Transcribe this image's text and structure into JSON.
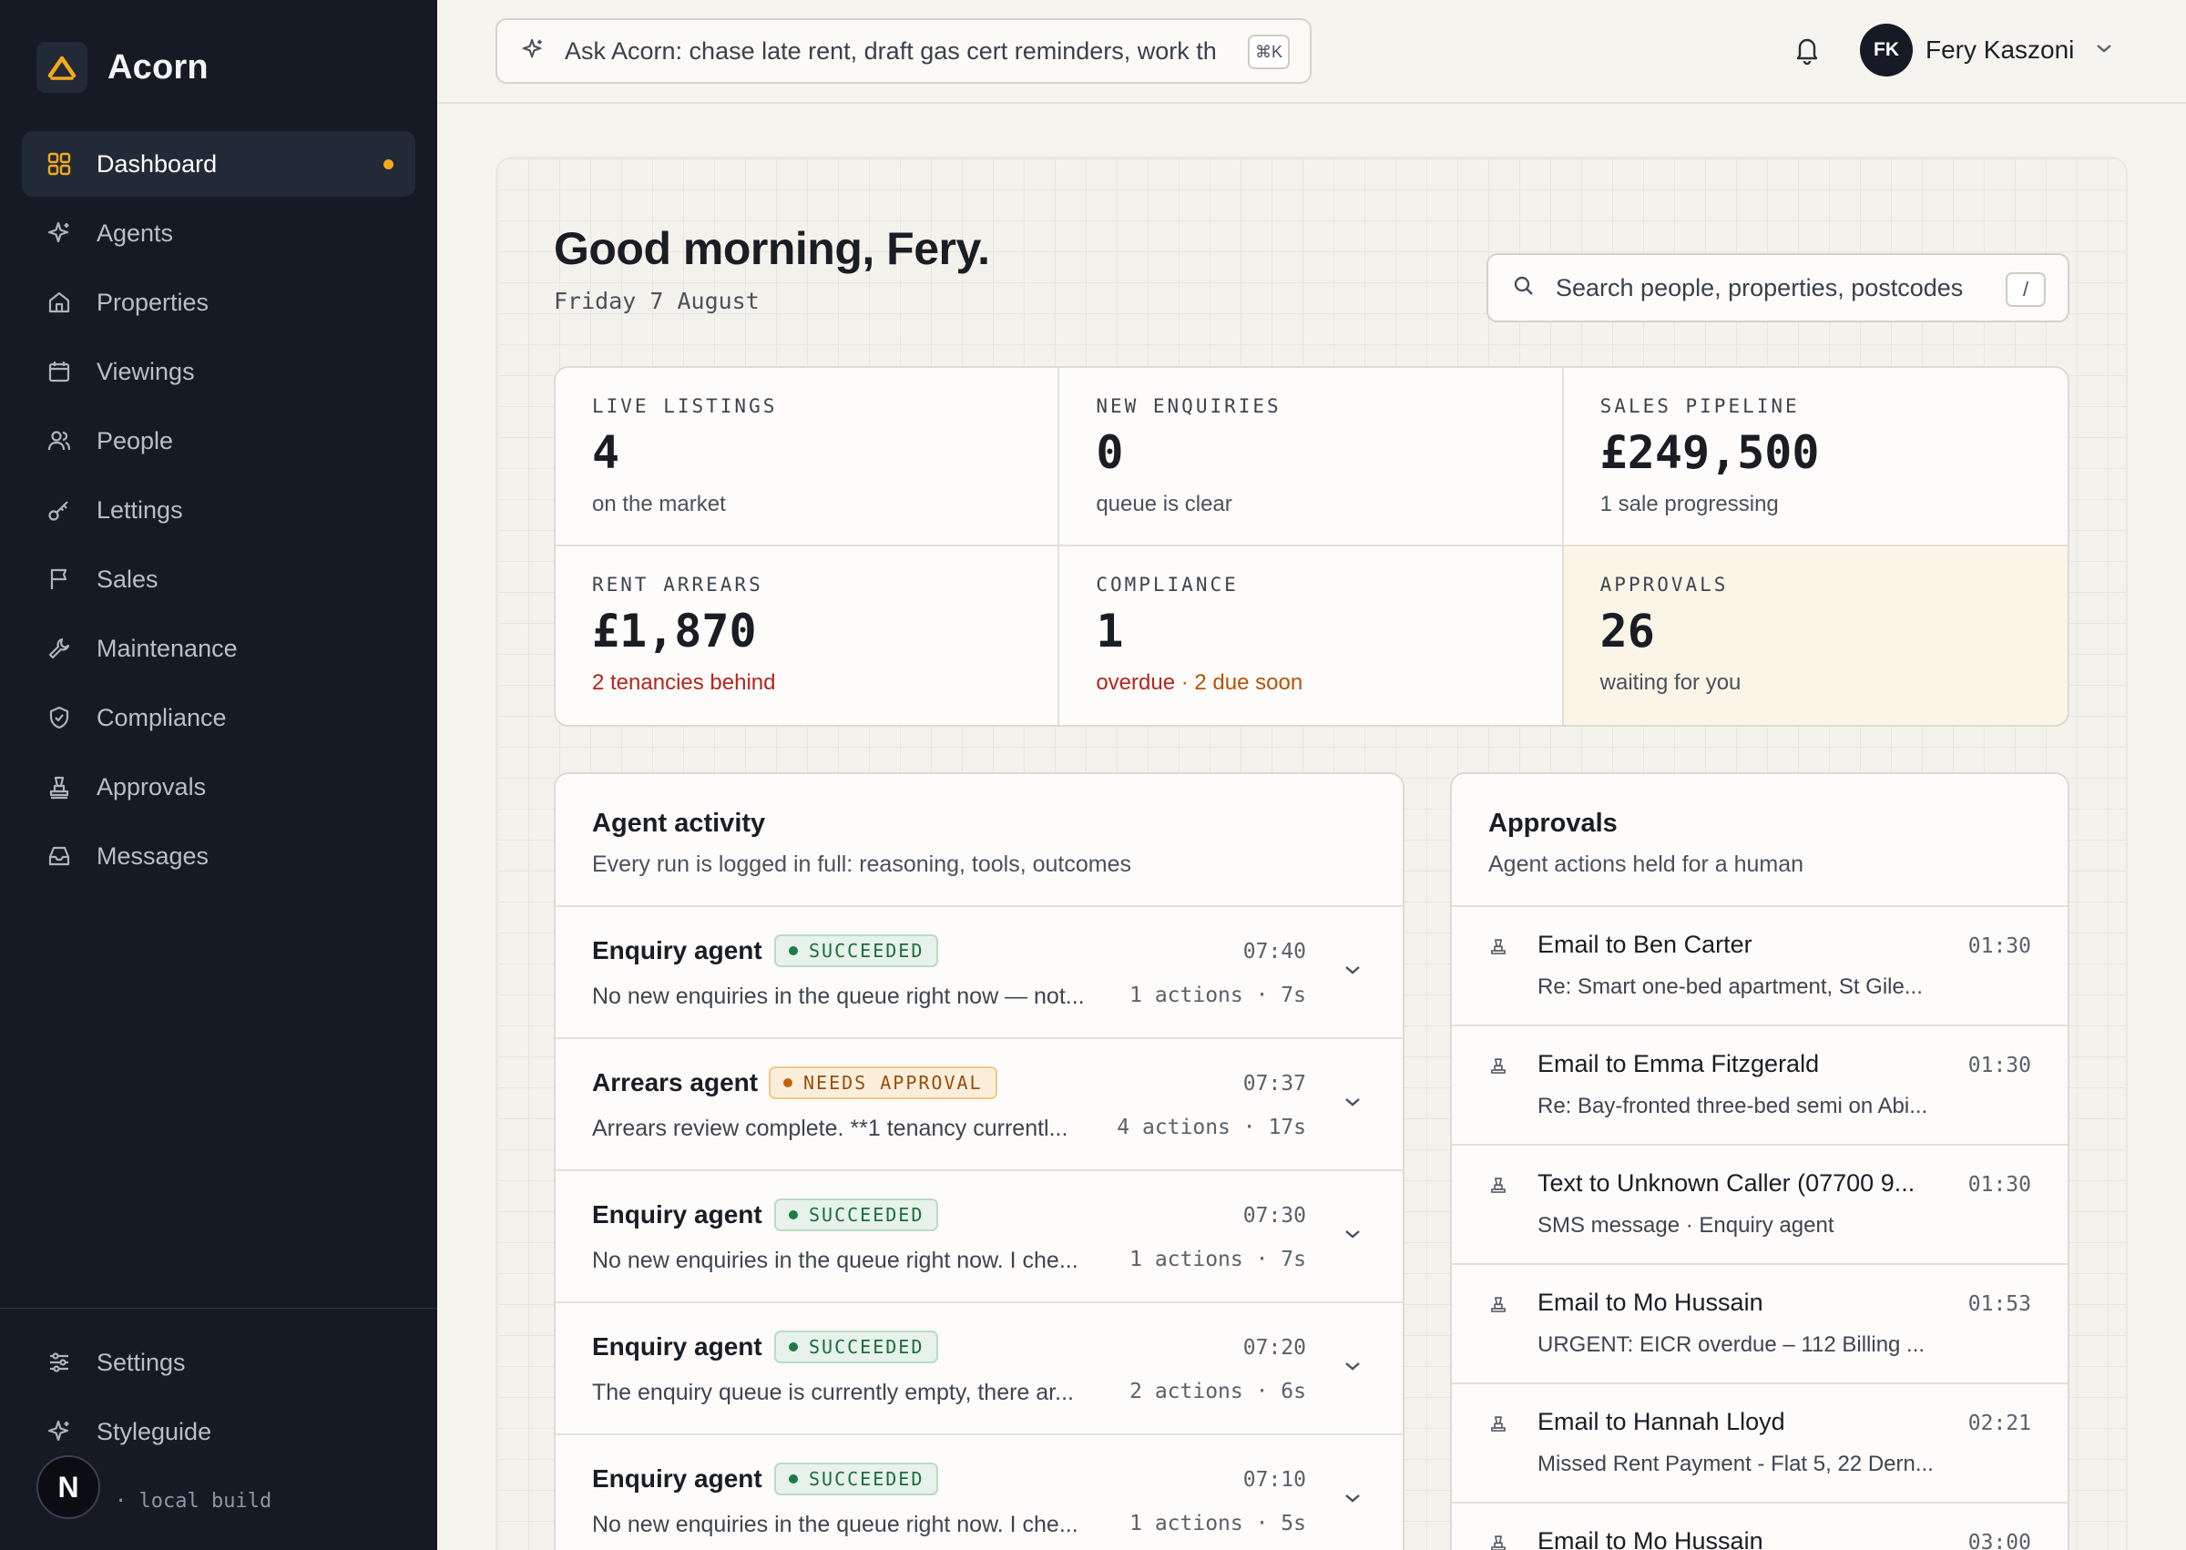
{
  "brand": {
    "name": "Acorn"
  },
  "sidebar": {
    "items": [
      {
        "label": "Dashboard",
        "icon": "grid-icon",
        "active": true
      },
      {
        "label": "Agents",
        "icon": "sparkle-icon"
      },
      {
        "label": "Properties",
        "icon": "home-icon"
      },
      {
        "label": "Viewings",
        "icon": "calendar-icon"
      },
      {
        "label": "People",
        "icon": "users-icon"
      },
      {
        "label": "Lettings",
        "icon": "key-icon"
      },
      {
        "label": "Sales",
        "icon": "flag-icon"
      },
      {
        "label": "Maintenance",
        "icon": "wrench-icon"
      },
      {
        "label": "Compliance",
        "icon": "shield-icon"
      },
      {
        "label": "Approvals",
        "icon": "stamp-icon"
      },
      {
        "label": "Messages",
        "icon": "inbox-icon"
      }
    ],
    "bottom": [
      {
        "label": "Settings",
        "icon": "sliders-icon"
      },
      {
        "label": "Styleguide",
        "icon": "sparkle-icon"
      }
    ],
    "build": "· local build",
    "n_badge": "N"
  },
  "topbar": {
    "ask_placeholder": "Ask Acorn: chase late rent, draft gas cert reminders, work th",
    "ask_shortcut": "⌘K",
    "user": {
      "initials": "FK",
      "name": "Fery Kaszoni"
    }
  },
  "header": {
    "greeting": "Good morning, Fery.",
    "date": "Friday 7 August",
    "search_placeholder": "Search people, properties, postcodes",
    "search_shortcut": "/"
  },
  "stats": [
    {
      "label": "LIVE LISTINGS",
      "value": "4",
      "sub": "on the market"
    },
    {
      "label": "NEW ENQUIRIES",
      "value": "0",
      "sub": "queue is clear"
    },
    {
      "label": "SALES PIPELINE",
      "value": "£249,500",
      "sub": "1 sale progressing"
    },
    {
      "label": "RENT ARREARS",
      "value": "£1,870",
      "sub": "2 tenancies behind"
    },
    {
      "label": "COMPLIANCE",
      "value": "1",
      "sub_a": "overdue",
      "sub_b": " · 2 due soon"
    },
    {
      "label": "APPROVALS",
      "value": "26",
      "sub": "waiting for you"
    }
  ],
  "activity": {
    "title": "Agent activity",
    "subtitle": "Every run is logged in full: reasoning, tools, outcomes",
    "rows": [
      {
        "agent": "Enquiry agent",
        "status": "SUCCEEDED",
        "summary": "No new enquiries in the queue right now — not...",
        "time": "07:40",
        "meta": "1 actions · 7s"
      },
      {
        "agent": "Arrears agent",
        "status": "NEEDS APPROVAL",
        "summary": "Arrears review complete. **1 tenancy currentl...",
        "time": "07:37",
        "meta": "4 actions · 17s"
      },
      {
        "agent": "Enquiry agent",
        "status": "SUCCEEDED",
        "summary": "No new enquiries in the queue right now. I che...",
        "time": "07:30",
        "meta": "1 actions · 7s"
      },
      {
        "agent": "Enquiry agent",
        "status": "SUCCEEDED",
        "summary": "The enquiry queue is currently empty, there ar...",
        "time": "07:20",
        "meta": "2 actions · 6s"
      },
      {
        "agent": "Enquiry agent",
        "status": "SUCCEEDED",
        "summary": "No new enquiries in the queue right now. I che...",
        "time": "07:10",
        "meta": "1 actions · 5s"
      }
    ]
  },
  "approvals": {
    "title": "Approvals",
    "subtitle": "Agent actions held for a human",
    "rows": [
      {
        "title": "Email to Ben Carter",
        "sub": "Re: Smart one-bed apartment, St Gile...",
        "time": "01:30"
      },
      {
        "title": "Email to Emma Fitzgerald",
        "sub": "Re: Bay-fronted three-bed semi on Abi...",
        "time": "01:30"
      },
      {
        "title": "Text to Unknown Caller (07700 9...",
        "sub": "SMS message · Enquiry agent",
        "time": "01:30"
      },
      {
        "title": "Email to Mo Hussain",
        "sub": "URGENT: EICR overdue – 112 Billing ...",
        "time": "01:53"
      },
      {
        "title": "Email to Hannah Lloyd",
        "sub": "Missed Rent Payment - Flat 5, 22 Dern...",
        "time": "02:21"
      },
      {
        "title": "Email to Mo Hussain",
        "sub": "",
        "time": "03:00"
      }
    ]
  },
  "colors": {
    "accent": "#f2a91d",
    "sidebar": "#151a24",
    "success": "#1d7a44",
    "warning": "#c2620c",
    "danger": "#b3261e"
  }
}
